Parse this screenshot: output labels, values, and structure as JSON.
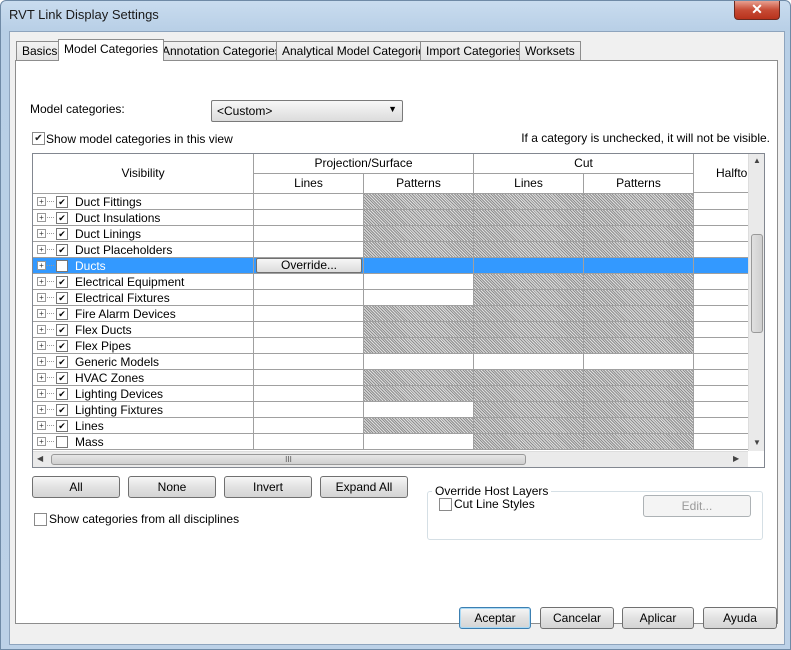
{
  "window": {
    "title": "RVT Link Display Settings",
    "close_glyph": "✕"
  },
  "tabs": [
    "Basics",
    "Model Categories",
    "Annotation Categories",
    "Analytical Model Categories",
    "Import Categories",
    "Worksets"
  ],
  "active_tab": "Model Categories",
  "model_categories": {
    "label": "Model categories:",
    "value": "<Custom>"
  },
  "show_in_view": {
    "label": "Show model categories in this view",
    "checked": true
  },
  "hint": "If a category is unchecked, it will not be visible.",
  "grid": {
    "headers": {
      "visibility": "Visibility",
      "projection": "Projection/Surface",
      "cut": "Cut",
      "halftone": "Halfto",
      "lines": "Lines",
      "patterns": "Patterns"
    },
    "override_label": "Override...",
    "scroll_grip": "III",
    "rows": [
      {
        "name": "Duct Fittings",
        "checked": true
      },
      {
        "name": "Duct Insulations",
        "checked": true
      },
      {
        "name": "Duct Linings",
        "checked": true
      },
      {
        "name": "Duct Placeholders",
        "checked": true
      },
      {
        "name": "Ducts",
        "checked": false,
        "selected": true
      },
      {
        "name": "Electrical Equipment",
        "checked": true
      },
      {
        "name": "Electrical Fixtures",
        "checked": true
      },
      {
        "name": "Fire Alarm Devices",
        "checked": true
      },
      {
        "name": "Flex Ducts",
        "checked": true
      },
      {
        "name": "Flex Pipes",
        "checked": true
      },
      {
        "name": "Generic Models",
        "checked": true
      },
      {
        "name": "HVAC Zones",
        "checked": true
      },
      {
        "name": "Lighting Devices",
        "checked": true
      },
      {
        "name": "Lighting Fixtures",
        "checked": true
      },
      {
        "name": "Lines",
        "checked": true
      },
      {
        "name": "Mass",
        "checked": false
      }
    ]
  },
  "buttons": {
    "all": "All",
    "none": "None",
    "invert": "Invert",
    "expand_all": "Expand All"
  },
  "show_all_disciplines": {
    "label": "Show categories from all disciplines",
    "checked": false
  },
  "override_host": {
    "title": "Override Host Layers",
    "cut_line_styles": "Cut Line Styles",
    "edit": "Edit..."
  },
  "footer": {
    "ok": "Aceptar",
    "cancel": "Cancelar",
    "apply": "Aplicar",
    "help": "Ayuda"
  }
}
